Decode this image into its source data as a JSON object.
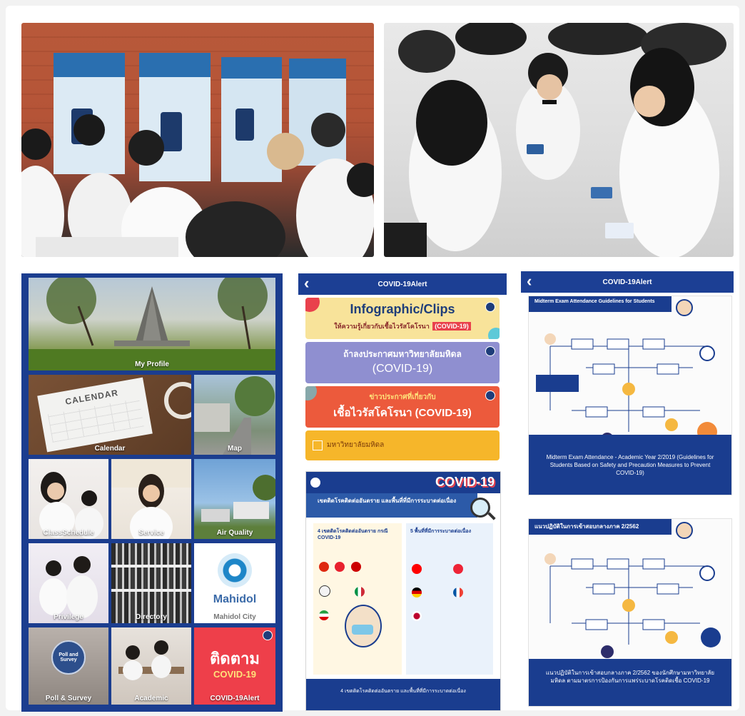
{
  "photos": {
    "left": {
      "label": ""
    },
    "right": {
      "label": ""
    }
  },
  "app_grid": {
    "tiles": [
      {
        "key": "my_profile",
        "label": "My Profile"
      },
      {
        "key": "calendar",
        "label": "Calendar",
        "calendar_heading": "CALENDAR"
      },
      {
        "key": "map",
        "label": "Map"
      },
      {
        "key": "class_schedule",
        "label": "ClassSchedule"
      },
      {
        "key": "service",
        "label": "Service"
      },
      {
        "key": "air_quality",
        "label": "Air Quality"
      },
      {
        "key": "privilege",
        "label": "Privilege"
      },
      {
        "key": "directory",
        "label": "Directory"
      },
      {
        "key": "mahidol_city",
        "label": "Mahidol City",
        "logo_text": "Mahidol"
      },
      {
        "key": "poll_survey",
        "label": "Poll & Survey",
        "badge_text": "Poll and Survey"
      },
      {
        "key": "academic",
        "label": "Academic"
      },
      {
        "key": "covid_alert",
        "label": "COVID-19Alert",
        "big_text": "ติดตาม",
        "sub_text": "COVID-19"
      }
    ]
  },
  "covid_screen_1": {
    "title": "COVID-19Alert",
    "card1_title": "Infographic/Clips",
    "card1_sub": "ให้ความรู้เกี่ยวกับเชื้อไวรัสโคโรนา",
    "card1_tag": "(COVID-19)",
    "card2_title": "ถ้าลงประกาศมหาวิทยาลัยมหิดล",
    "card2_sub": "(COVID-19)",
    "card3_title": "ข่าวประกาศที่เกี่ยวกับ",
    "card3_sub": "เชื้อไวรัสโคโรนา (COVID-19)",
    "card4_title": "มหาวิทยาลัยมหิดล"
  },
  "covid_infographic": {
    "badge": "COVID-19",
    "headline": "เขตติดโรคติดต่ออันตราย และพื้นที่ที่มีการระบาดต่อเนื่อง",
    "col1_title": "4 เขตติดโรคติดต่ออันตราย กรณี COVID-19",
    "col2_title": "5 พื้นที่ที่มีการระบาดต่อเนื่อง",
    "footer": "4 เขตติดโรคติดต่ออันตราย และพื้นที่ที่มีการระบาดต่อเนื่อง"
  },
  "covid_screen_2": {
    "title": "COVID-19Alert",
    "flow1_heading": "Midterm Exam Attendance Guidelines for Students",
    "flow1_caption": "Midterm Exam Attendance - Academic Year 2/2019 (Guidelines for Students Based on Safety and Precaution Measures to Prevent COVID-19)",
    "flow2_heading": "แนวปฏิบัติในการเข้าสอบกลางภาค 2/2562",
    "flow2_caption": "แนวปฏิบัติในการเข้าสอบกลางภาค 2/2562 ของนักศึกษามหาวิทยาลัยมหิดล ตามมาตรการป้องกันการแพร่ระบาดโรคติดเชื้อ COVID-19"
  }
}
